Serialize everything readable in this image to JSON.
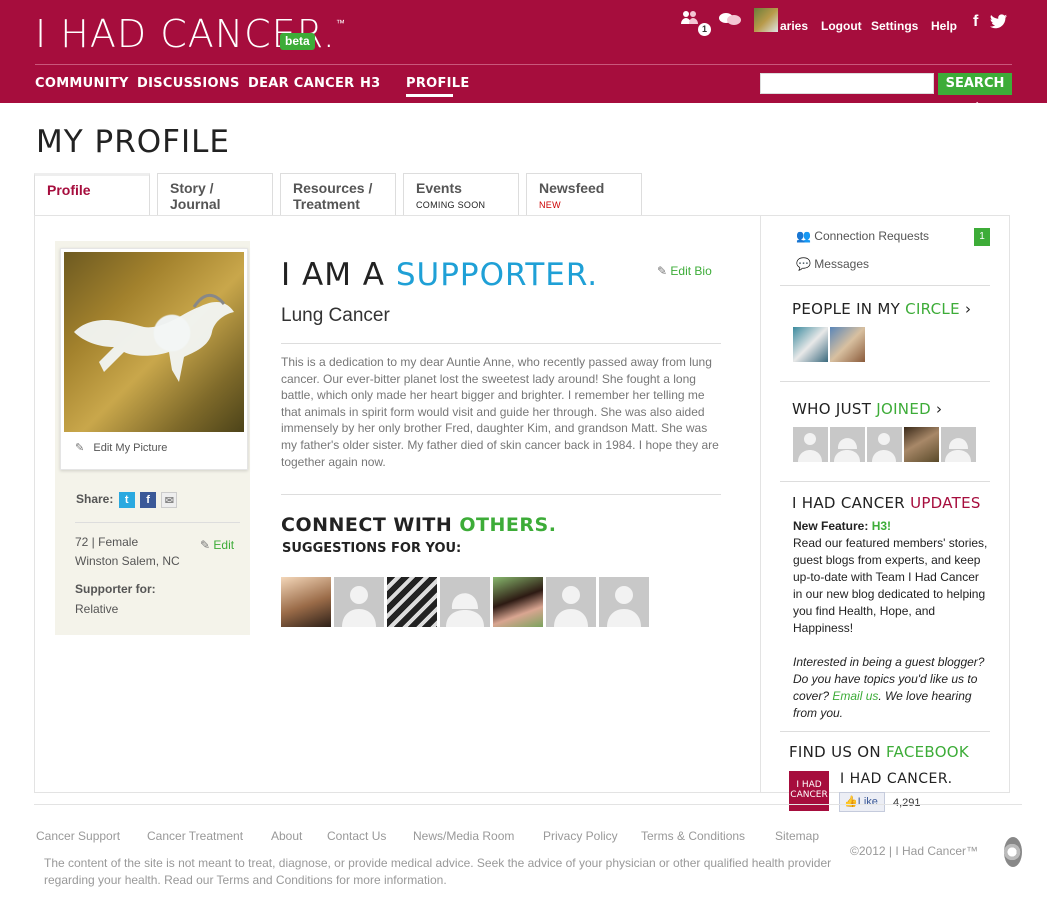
{
  "header": {
    "logo_text": "I HAD CANCER.",
    "logo_tm": "™",
    "beta": "beta",
    "notifications_count": "1",
    "username": "aries",
    "logout": "Logout",
    "settings": "Settings",
    "help": "Help"
  },
  "nav": {
    "items": [
      "COMMUNITY",
      "DISCUSSIONS",
      "DEAR CANCER",
      "H3",
      "PROFILE"
    ],
    "active": "PROFILE"
  },
  "search": {
    "placeholder": "",
    "button": "SEARCH →"
  },
  "page": {
    "title": "MY PROFILE"
  },
  "tabs": [
    {
      "line1": "Profile",
      "line2": "",
      "sub": ""
    },
    {
      "line1": "Story /",
      "line2": "Journal",
      "sub": ""
    },
    {
      "line1": "Resources /",
      "line2": "Treatment",
      "sub": ""
    },
    {
      "line1": "Events",
      "line2": "",
      "sub": "COMING SOON"
    },
    {
      "line1": "Newsfeed",
      "line2": "",
      "sub": "NEW"
    }
  ],
  "profile": {
    "edit_picture": "Edit My Picture",
    "share_label": "Share:",
    "age_gender": "72 | Female",
    "location": "Winston Salem, NC",
    "edit": "Edit",
    "supporter_label": "Supporter for:",
    "supporter_value": "Relative",
    "iam_prefix": "I AM A ",
    "role": "SUPPORTER.",
    "edit_bio": "Edit Bio",
    "cancer_type": "Lung Cancer",
    "bio": "This is a dedication to my dear Auntie Anne, who recently passed away from lung cancer. Our ever-bitter planet lost the sweetest lady around! She fought a long battle, which only made her heart bigger and brighter. I remember her telling me that animals in spirit form would visit and guide her through. She was also aided immensely by her only brother Fred, daughter Kim, and grandson Matt. She was my father's older sister. My father died of skin cancer back in 1984. I hope they are together again now."
  },
  "connect": {
    "title_a": "CONNECT WITH ",
    "title_b": "OTHERS.",
    "subtitle": "SUGGESTIONS FOR YOU:"
  },
  "sidebar": {
    "connection_requests": "Connection Requests",
    "connection_count": "1",
    "messages": "Messages",
    "circle_a": "PEOPLE IN MY ",
    "circle_b": "CIRCLE",
    "joined_a": "WHO JUST ",
    "joined_b": "JOINED",
    "updates_a": "I HAD CANCER ",
    "updates_b": "UPDATES",
    "feature_label": "New Feature: ",
    "feature_name": "H3!",
    "updates_body": "Read our featured members' stories, guest blogs from experts, and keep up-to-date with Team I Had Cancer in our new blog dedicated to helping you find Health, Hope, and Happiness!",
    "guest_text_a": "Interested in being a guest blogger? Do you have topics you'd like us to cover? ",
    "guest_link": "Email us",
    "guest_text_b": ". We love hearing from you.",
    "facebook_a": "FIND US ON ",
    "facebook_b": "FACEBOOK",
    "fb_logo_line1": "I HAD",
    "fb_logo_line2": "CANCER",
    "fb_name": "I HAD CANCER.",
    "fb_like": "Like",
    "fb_count": "4,291"
  },
  "footer": {
    "links": [
      "Cancer Support",
      "Cancer Treatment",
      "About",
      "Contact Us",
      "News/Media Room",
      "Privacy Policy",
      "Terms & Conditions",
      "Sitemap"
    ],
    "disclaimer": "The content of the site is not meant to treat, diagnose, or provide medical advice. Seek the advice of your physician or other qualified health provider regarding your health. Read our Terms and Conditions for more information.",
    "copyright": "©2012 | I Had Cancer™"
  },
  "colors": {
    "brand": "#a60d3d",
    "accent_green": "#3dac38",
    "accent_blue": "#1fa0d6"
  }
}
